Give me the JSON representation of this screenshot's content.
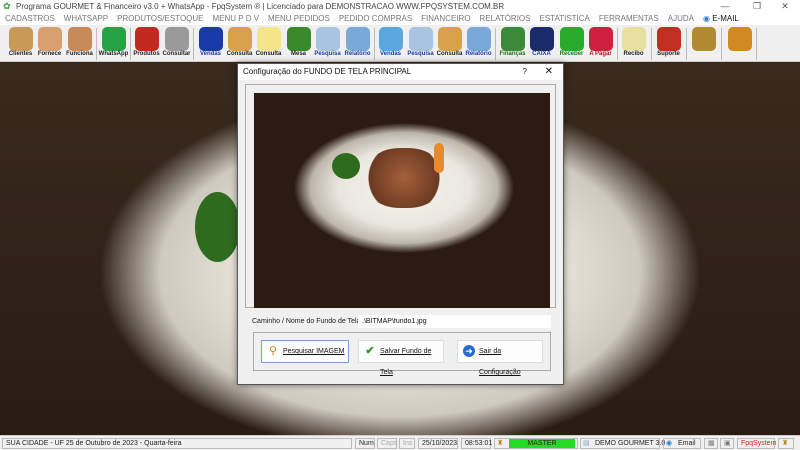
{
  "window": {
    "title": "Programa GOURMET & Financeiro v3.0 + WhatsApp - FpqSystem ® | Licenciado para  DEMONSTRACAO WWW.FPQSYSTEM.COM.BR",
    "minimize": "—",
    "maximize": "❐",
    "close": "✕"
  },
  "menu": [
    "CADASTROS",
    "WHATSAPP",
    "PRODUTOS/ESTOQUE",
    "MENU P D V",
    "MENU PEDIDOS",
    "PEDIDO COMPRAS",
    "FINANCEIRO",
    "RELATÓRIOS",
    "ESTATISTICA",
    "FERRAMENTAS",
    "AJUDA"
  ],
  "menu_email": "E-MAIL",
  "toolbar": [
    {
      "label": "Clientes",
      "color": "#c79a5a",
      "lc": "#222"
    },
    {
      "label": "Fornece",
      "color": "#d8a070",
      "lc": "#222"
    },
    {
      "label": "Funciona",
      "color": "#c98a5a",
      "lc": "#222"
    },
    {
      "label": "WhatsApp",
      "color": "#25a244",
      "lc": "#222"
    },
    {
      "label": "Produtos",
      "color": "#c02a20",
      "lc": "#222"
    },
    {
      "label": "Consultar",
      "color": "#9a9a9a",
      "lc": "#222"
    },
    {
      "label": "Vendas",
      "color": "#1a3aa8",
      "lc": "#1a3aa8"
    },
    {
      "label": "Consulta",
      "color": "#d9a24a",
      "lc": "#222"
    },
    {
      "label": "Consulta",
      "color": "#f4e48a",
      "lc": "#222"
    },
    {
      "label": "Mesa",
      "color": "#3a8a2a",
      "lc": "#222"
    },
    {
      "label": "Pesquisa",
      "color": "#a8c4e0",
      "lc": "#1a3aa8"
    },
    {
      "label": "Relatório",
      "color": "#7aa8d8",
      "lc": "#1a3aa8"
    },
    {
      "label": "Vendas",
      "color": "#5aa8e0",
      "lc": "#1a3aa8"
    },
    {
      "label": "Pesquisa",
      "color": "#a8c4e0",
      "lc": "#1a3aa8"
    },
    {
      "label": "Consulta",
      "color": "#d9a24a",
      "lc": "#222"
    },
    {
      "label": "Relatório",
      "color": "#7aa8d8",
      "lc": "#1a3aa8"
    },
    {
      "label": "Finanças",
      "color": "#3a8a3a",
      "lc": "#1a6a1a"
    },
    {
      "label": "CAIXA",
      "color": "#1a2a6a",
      "lc": "#1a3aa8"
    },
    {
      "label": "Receber",
      "color": "#2aaa2a",
      "lc": "#1a7a1a"
    },
    {
      "label": "A Pagar",
      "color": "#d02040",
      "lc": "#c01010"
    },
    {
      "label": "Recibo",
      "color": "#e8e0a0",
      "lc": "#222"
    },
    {
      "label": "Suporte",
      "color": "#c03020",
      "lc": "#222"
    },
    {
      "label": "",
      "color": "#b08a30",
      "lc": "#222"
    },
    {
      "label": "",
      "color": "#d08a20",
      "lc": "#222"
    }
  ],
  "dialog": {
    "title": "Configuração do FUNDO DE TELA PRINCIPAL",
    "help": "?",
    "close": "✕",
    "path_label": "Caminho / Nome do Fundo de Tela",
    "path_value": ".\\BITMAP\\fundo1.jpg",
    "buttons": {
      "search": "Pesquisar IMAGEM",
      "save": "Salvar Fundo de Tela",
      "exit": "Sair da Configuração"
    }
  },
  "status": {
    "city_date": "SUA CIDADE - UF 25 de Outubro de 2023 - Quarta-feira",
    "num": "Num",
    "caps": "Caps",
    "ins": "Ins",
    "date": "25/10/2023",
    "time": "08:53:01",
    "user": "MASTER",
    "company": "DEMO GOURMET 3.0",
    "email": "Email",
    "brand": "FpqSystem"
  }
}
